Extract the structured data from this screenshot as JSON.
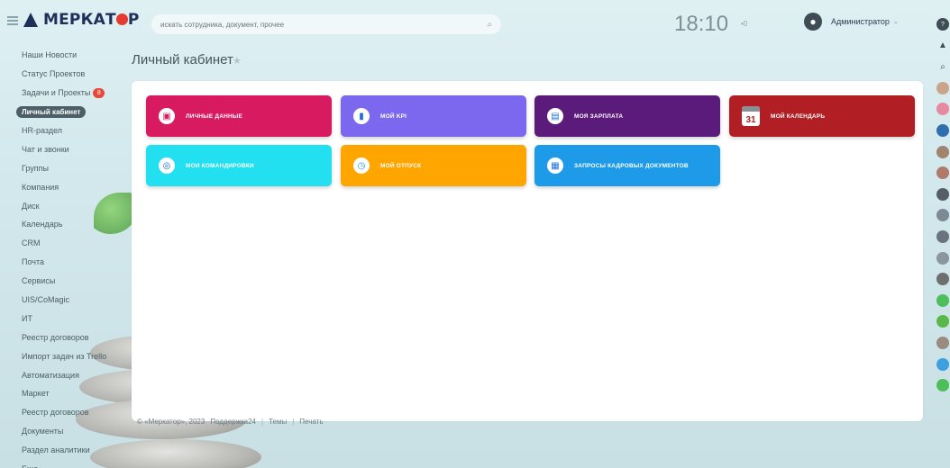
{
  "header": {
    "logo_text_a": "МЕРКАТ",
    "logo_text_b": "Р",
    "search_placeholder": "искать сотрудника, документ, прочее",
    "clock": "18:10",
    "notifications": "•0",
    "user_name": "Администратор"
  },
  "sidebar": {
    "items": [
      {
        "label": "Наши Новости"
      },
      {
        "label": "Статус Проектов"
      },
      {
        "label": "Задачи и Проекты",
        "badge": "8"
      },
      {
        "label": "Личный кабинет",
        "active": true
      },
      {
        "label": "HR-раздел"
      },
      {
        "label": "Чат и звонки"
      },
      {
        "label": "Группы"
      },
      {
        "label": "Компания"
      },
      {
        "label": "Диск"
      },
      {
        "label": "Календарь"
      },
      {
        "label": "CRM"
      },
      {
        "label": "Почта"
      },
      {
        "label": "Сервисы"
      },
      {
        "label": "UIS/CoMagic"
      },
      {
        "label": "ИТ"
      },
      {
        "label": "Реестр договоров"
      },
      {
        "label": "Импорт задач из Trello"
      },
      {
        "label": "Автоматизация"
      },
      {
        "label": "Маркет"
      },
      {
        "label": "Реестр договоров"
      },
      {
        "label": "Документы"
      },
      {
        "label": "Раздел аналитики"
      },
      {
        "label": "Еще"
      }
    ]
  },
  "main": {
    "title": "Личный кабинет",
    "tiles": [
      {
        "label": "ЛИЧНЫЕ ДАННЫЕ",
        "color": "#d81b60",
        "icon": "id-card-icon"
      },
      {
        "label": "МОЙ KPI",
        "color": "#7b68ee",
        "icon": "document-icon"
      },
      {
        "label": "МОЯ ЗАРПЛАТА",
        "color": "#5b1b7a",
        "icon": "wallet-icon"
      },
      {
        "label": "МОЙ КАЛЕНДАРЬ",
        "color": "#b11f24",
        "icon": "calendar-icon",
        "day": "31"
      },
      {
        "label": "МОИ КОМАНДИРОВКИ",
        "color": "#22e0f0",
        "icon": "globe-icon"
      },
      {
        "label": "МОЙ ОТПУСК",
        "color": "#ffa500",
        "icon": "clock-icon"
      },
      {
        "label": "ЗАПРОСЫ КАДРОВЫХ ДОКУМЕНТОВ",
        "color": "#1e9be8",
        "icon": "printer-icon"
      }
    ]
  },
  "footer": {
    "copyright": "© «Меркатор», 2023",
    "powered": "Поддержка24",
    "themes": "Темы",
    "print": "Печать"
  },
  "colors": {
    "brand": "#1f2f5a",
    "brand_accent": "#e53a2f"
  }
}
